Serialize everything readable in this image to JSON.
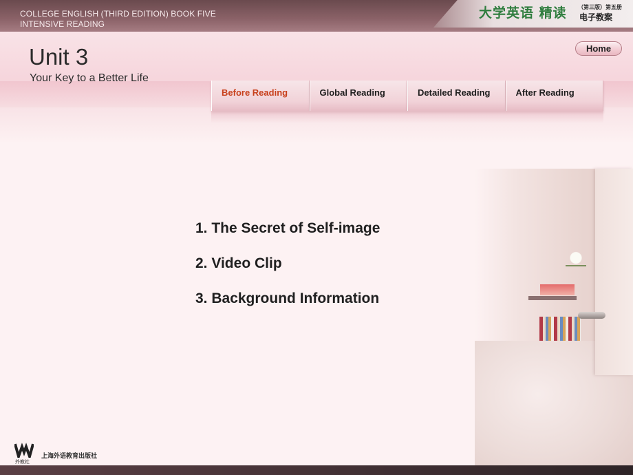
{
  "header": {
    "course_line1": "COLLEGE ENGLISH (THIRD EDITION) BOOK FIVE",
    "course_line2": "INTENSIVE READING",
    "brand_cn": "大学英语 精读",
    "brand_edition": "（第三版）第五册",
    "brand_sub": "电子教案"
  },
  "unit": {
    "title": "Unit 3",
    "subtitle": "Your Key to a Better Life"
  },
  "home_label": "Home",
  "tabs": [
    {
      "label": "Before Reading",
      "active": true
    },
    {
      "label": "Global Reading",
      "active": false
    },
    {
      "label": "Detailed Reading",
      "active": false
    },
    {
      "label": "After Reading",
      "active": false
    }
  ],
  "content_items": [
    "1. The Secret of Self-image",
    "2. Video Clip",
    "3. Background Information"
  ],
  "footer": {
    "logo_sub": "外教社",
    "publisher": "上海外语教育出版社"
  },
  "colors": {
    "active_tab": "#c8401c",
    "brand_green": "#2f7d3e",
    "top_bar": "#6a4a4e"
  }
}
